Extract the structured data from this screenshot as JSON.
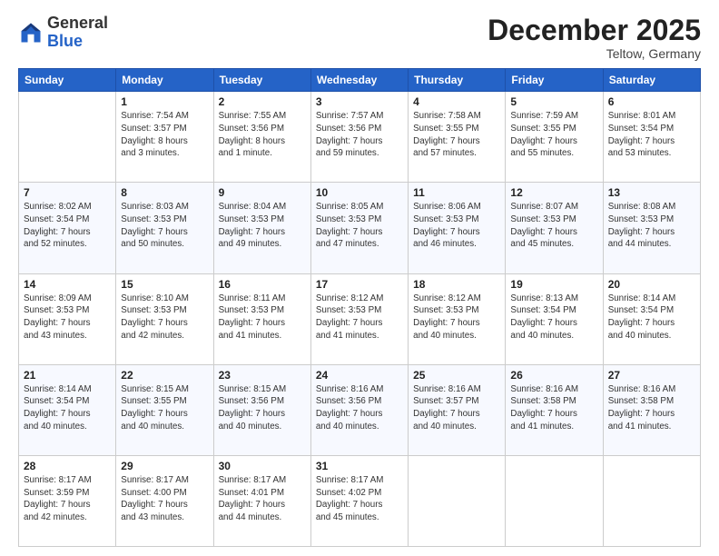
{
  "logo": {
    "general": "General",
    "blue": "Blue"
  },
  "header": {
    "month": "December 2025",
    "location": "Teltow, Germany"
  },
  "days_of_week": [
    "Sunday",
    "Monday",
    "Tuesday",
    "Wednesday",
    "Thursday",
    "Friday",
    "Saturday"
  ],
  "weeks": [
    [
      {
        "day": "",
        "info": ""
      },
      {
        "day": "1",
        "info": "Sunrise: 7:54 AM\nSunset: 3:57 PM\nDaylight: 8 hours\nand 3 minutes."
      },
      {
        "day": "2",
        "info": "Sunrise: 7:55 AM\nSunset: 3:56 PM\nDaylight: 8 hours\nand 1 minute."
      },
      {
        "day": "3",
        "info": "Sunrise: 7:57 AM\nSunset: 3:56 PM\nDaylight: 7 hours\nand 59 minutes."
      },
      {
        "day": "4",
        "info": "Sunrise: 7:58 AM\nSunset: 3:55 PM\nDaylight: 7 hours\nand 57 minutes."
      },
      {
        "day": "5",
        "info": "Sunrise: 7:59 AM\nSunset: 3:55 PM\nDaylight: 7 hours\nand 55 minutes."
      },
      {
        "day": "6",
        "info": "Sunrise: 8:01 AM\nSunset: 3:54 PM\nDaylight: 7 hours\nand 53 minutes."
      }
    ],
    [
      {
        "day": "7",
        "info": "Sunrise: 8:02 AM\nSunset: 3:54 PM\nDaylight: 7 hours\nand 52 minutes."
      },
      {
        "day": "8",
        "info": "Sunrise: 8:03 AM\nSunset: 3:53 PM\nDaylight: 7 hours\nand 50 minutes."
      },
      {
        "day": "9",
        "info": "Sunrise: 8:04 AM\nSunset: 3:53 PM\nDaylight: 7 hours\nand 49 minutes."
      },
      {
        "day": "10",
        "info": "Sunrise: 8:05 AM\nSunset: 3:53 PM\nDaylight: 7 hours\nand 47 minutes."
      },
      {
        "day": "11",
        "info": "Sunrise: 8:06 AM\nSunset: 3:53 PM\nDaylight: 7 hours\nand 46 minutes."
      },
      {
        "day": "12",
        "info": "Sunrise: 8:07 AM\nSunset: 3:53 PM\nDaylight: 7 hours\nand 45 minutes."
      },
      {
        "day": "13",
        "info": "Sunrise: 8:08 AM\nSunset: 3:53 PM\nDaylight: 7 hours\nand 44 minutes."
      }
    ],
    [
      {
        "day": "14",
        "info": "Sunrise: 8:09 AM\nSunset: 3:53 PM\nDaylight: 7 hours\nand 43 minutes."
      },
      {
        "day": "15",
        "info": "Sunrise: 8:10 AM\nSunset: 3:53 PM\nDaylight: 7 hours\nand 42 minutes."
      },
      {
        "day": "16",
        "info": "Sunrise: 8:11 AM\nSunset: 3:53 PM\nDaylight: 7 hours\nand 41 minutes."
      },
      {
        "day": "17",
        "info": "Sunrise: 8:12 AM\nSunset: 3:53 PM\nDaylight: 7 hours\nand 41 minutes."
      },
      {
        "day": "18",
        "info": "Sunrise: 8:12 AM\nSunset: 3:53 PM\nDaylight: 7 hours\nand 40 minutes."
      },
      {
        "day": "19",
        "info": "Sunrise: 8:13 AM\nSunset: 3:54 PM\nDaylight: 7 hours\nand 40 minutes."
      },
      {
        "day": "20",
        "info": "Sunrise: 8:14 AM\nSunset: 3:54 PM\nDaylight: 7 hours\nand 40 minutes."
      }
    ],
    [
      {
        "day": "21",
        "info": "Sunrise: 8:14 AM\nSunset: 3:54 PM\nDaylight: 7 hours\nand 40 minutes."
      },
      {
        "day": "22",
        "info": "Sunrise: 8:15 AM\nSunset: 3:55 PM\nDaylight: 7 hours\nand 40 minutes."
      },
      {
        "day": "23",
        "info": "Sunrise: 8:15 AM\nSunset: 3:56 PM\nDaylight: 7 hours\nand 40 minutes."
      },
      {
        "day": "24",
        "info": "Sunrise: 8:16 AM\nSunset: 3:56 PM\nDaylight: 7 hours\nand 40 minutes."
      },
      {
        "day": "25",
        "info": "Sunrise: 8:16 AM\nSunset: 3:57 PM\nDaylight: 7 hours\nand 40 minutes."
      },
      {
        "day": "26",
        "info": "Sunrise: 8:16 AM\nSunset: 3:58 PM\nDaylight: 7 hours\nand 41 minutes."
      },
      {
        "day": "27",
        "info": "Sunrise: 8:16 AM\nSunset: 3:58 PM\nDaylight: 7 hours\nand 41 minutes."
      }
    ],
    [
      {
        "day": "28",
        "info": "Sunrise: 8:17 AM\nSunset: 3:59 PM\nDaylight: 7 hours\nand 42 minutes."
      },
      {
        "day": "29",
        "info": "Sunrise: 8:17 AM\nSunset: 4:00 PM\nDaylight: 7 hours\nand 43 minutes."
      },
      {
        "day": "30",
        "info": "Sunrise: 8:17 AM\nSunset: 4:01 PM\nDaylight: 7 hours\nand 44 minutes."
      },
      {
        "day": "31",
        "info": "Sunrise: 8:17 AM\nSunset: 4:02 PM\nDaylight: 7 hours\nand 45 minutes."
      },
      {
        "day": "",
        "info": ""
      },
      {
        "day": "",
        "info": ""
      },
      {
        "day": "",
        "info": ""
      }
    ]
  ]
}
